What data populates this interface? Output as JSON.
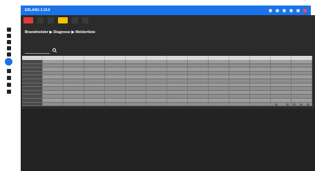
{
  "app": {
    "title": "ERLANG 2.10.0"
  },
  "titlebar": {
    "icons": [
      "circle-half-icon",
      "gear-icon",
      "plus-icon",
      "user-icon",
      "power-icon",
      "close-icon"
    ]
  },
  "sidebar": {
    "items": [
      "home-icon",
      "list-icon",
      "settings-icon",
      "lock-icon",
      "chart-icon",
      "active-icon",
      "tools-icon",
      "doc-icon",
      "edit-icon",
      "wrench-icon"
    ]
  },
  "toolbar": {
    "items": [
      "red-tool",
      "tool",
      "tool",
      "yellow-tool",
      "tool",
      "tool"
    ]
  },
  "breadcrumb": {
    "text": "Brandmelder ▶ Diagnose ▶ Melderliste"
  },
  "subtabs": [
    {
      "label": "",
      "active": true
    },
    {
      "label": "",
      "active": false
    }
  ],
  "search": {
    "label": "",
    "value": ""
  },
  "table": {
    "headers": [
      "",
      "",
      "",
      "",
      "",
      "",
      "",
      "",
      "",
      "",
      "",
      "",
      "",
      ""
    ],
    "rows": [
      [
        "",
        "",
        "",
        "",
        "",
        "",
        "",
        "",
        "",
        "",
        "",
        "",
        "",
        ""
      ],
      [
        "",
        "",
        "",
        "",
        "",
        "",
        "",
        "",
        "",
        "",
        "",
        "",
        "",
        ""
      ],
      [
        "",
        "",
        "",
        "",
        "",
        "",
        "",
        "",
        "",
        "",
        "",
        "",
        "",
        ""
      ],
      [
        "",
        "",
        "",
        "",
        "",
        "",
        "",
        "",
        "",
        "",
        "",
        "",
        "",
        ""
      ],
      [
        "",
        "",
        "",
        "",
        "",
        "",
        "",
        "",
        "",
        "",
        "",
        "",
        "",
        ""
      ],
      [
        "",
        "",
        "",
        "",
        "",
        "",
        "",
        "",
        "",
        "",
        "",
        "",
        "",
        ""
      ],
      [
        "",
        "",
        "",
        "",
        "",
        "",
        "",
        "",
        "",
        "",
        "",
        "",
        "",
        ""
      ],
      [
        "",
        "",
        "",
        "",
        "",
        "",
        "",
        "",
        "",
        "",
        "",
        "",
        "",
        ""
      ],
      [
        "",
        "",
        "",
        "",
        "",
        "",
        "",
        "",
        "",
        "",
        "",
        "",
        "",
        ""
      ],
      [
        "",
        "",
        "",
        "",
        "",
        "",
        "",
        "",
        "",
        "",
        "",
        "",
        "",
        ""
      ],
      [
        "",
        "",
        "",
        "",
        "",
        "",
        "",
        "",
        "",
        "",
        "",
        "",
        "",
        ""
      ],
      [
        "",
        "",
        "",
        "",
        "",
        "",
        "",
        "",
        "",
        "",
        "",
        "",
        "",
        ""
      ]
    ]
  },
  "pagination": {
    "rows_per_page_label": "",
    "range_label": ""
  },
  "colors": {
    "accent": "#1a73e8",
    "panel": "#2b2b2b",
    "alert": "#e53935",
    "warning": "#f2c200"
  }
}
